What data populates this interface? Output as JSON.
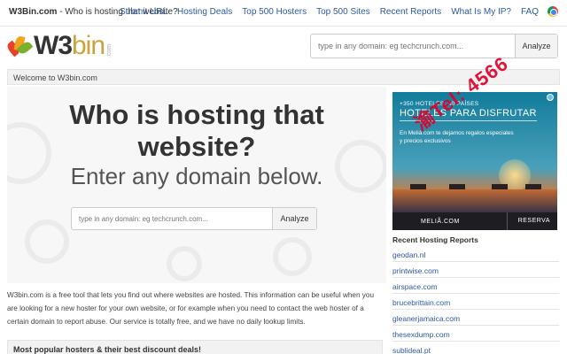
{
  "topnav": {
    "brand_bold": "W3Bin.com",
    "brand_rest": " - Who is hosting that website?",
    "links": [
      "Submit URL",
      "Hosting Deals",
      "Top 500 Hosters",
      "Top 500 Sites",
      "Recent Reports",
      "What Is My IP?",
      "FAQ"
    ],
    "browser_icon": "chrome-icon"
  },
  "logo": {
    "w3": "W3",
    "bin": "bin",
    "dotcom": ".com"
  },
  "header_search": {
    "placeholder": "type in any domain: eg techcrunch.com...",
    "button": "Analyze"
  },
  "welcome": "Welcome to W3bin.com",
  "hero": {
    "title": "Who is hosting that website?",
    "subtitle": "Enter any domain below.",
    "search_placeholder": "type in any domain: eg techcrunch.com...",
    "search_button": "Analyze"
  },
  "description": "W3bin.com is a free tool that lets you find out where websites are hosted. This information can be useful when you are looking for a new hoster for your own website, or for example when you need to contact the web hoster of a certain domain to report abuse. Our service is totally free, and we have no daily lookup limits.",
  "deals_title": "Most popular hosters & their best discount deals!",
  "ad": {
    "top": "+350 HOTELES. 40 PAÍSES",
    "headline": "HOTELES PARA DISFRUTAR",
    "body": "En Meliá.com te dejamos regalos especiales y precios exclusivos",
    "brand": "MELIÃ.COM",
    "cta": "RESERVA"
  },
  "watermark": "渝Tel: 4566",
  "recent": {
    "title": "Recent Hosting Reports",
    "items": [
      "geodan.nl",
      "printwise.com",
      "airspace.com",
      "brucebrittain.com",
      "gleanerjamaica.com",
      "thesexdump.com",
      "sublideal.pt"
    ]
  }
}
